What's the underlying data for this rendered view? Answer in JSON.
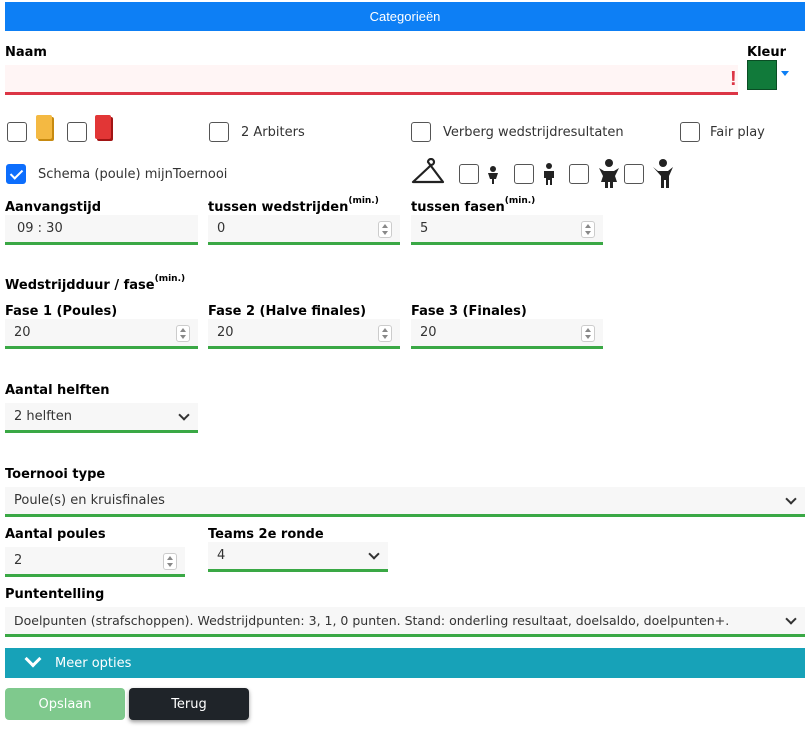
{
  "header": {
    "title": "Categorieën"
  },
  "naam": {
    "label": "Naam",
    "value": "",
    "error_mark": "!"
  },
  "kleur": {
    "label": "Kleur",
    "color": "#117a3a"
  },
  "options": {
    "arbiters": "2 Arbiters",
    "verberg": "Verberg wedstrijdresultaten",
    "fairplay": "Fair play",
    "schema": "Schema (poule) mijnToernooi"
  },
  "times": {
    "aanvang_label": "Aanvangstijd",
    "aanvang_value": "09 : 30",
    "tussen_wed_label": "tussen wedstrijden",
    "tussen_wed_unit": "(min.)",
    "tussen_wed_value": "0",
    "tussen_fasen_label": "tussen fasen",
    "tussen_fasen_unit": "(min.)",
    "tussen_fasen_value": "5"
  },
  "duur": {
    "label": "Wedstrijdduur / fase",
    "unit": "(min.)",
    "fase1_label": "Fase 1 (Poules)",
    "fase1_value": "20",
    "fase2_label": "Fase 2 (Halve finales)",
    "fase2_value": "20",
    "fase3_label": "Fase 3 (Finales)",
    "fase3_value": "20"
  },
  "helften": {
    "label": "Aantal helften",
    "value": "2 helften"
  },
  "toernooi": {
    "label": "Toernooi type",
    "value": "Poule(s) en kruisfinales"
  },
  "poules": {
    "label": "Aantal poules",
    "value": "2"
  },
  "teams": {
    "label": "Teams 2e ronde",
    "value": "4"
  },
  "punten": {
    "label": "Puntentelling",
    "value": "Doelpunten (strafschoppen). Wedstrijdpunten: 3, 1, 0 punten. Stand: onderling resultaat, doelsaldo, doelpunten+."
  },
  "meer": {
    "label": "Meer opties"
  },
  "buttons": {
    "save": "Opslaan",
    "back": "Terug"
  }
}
